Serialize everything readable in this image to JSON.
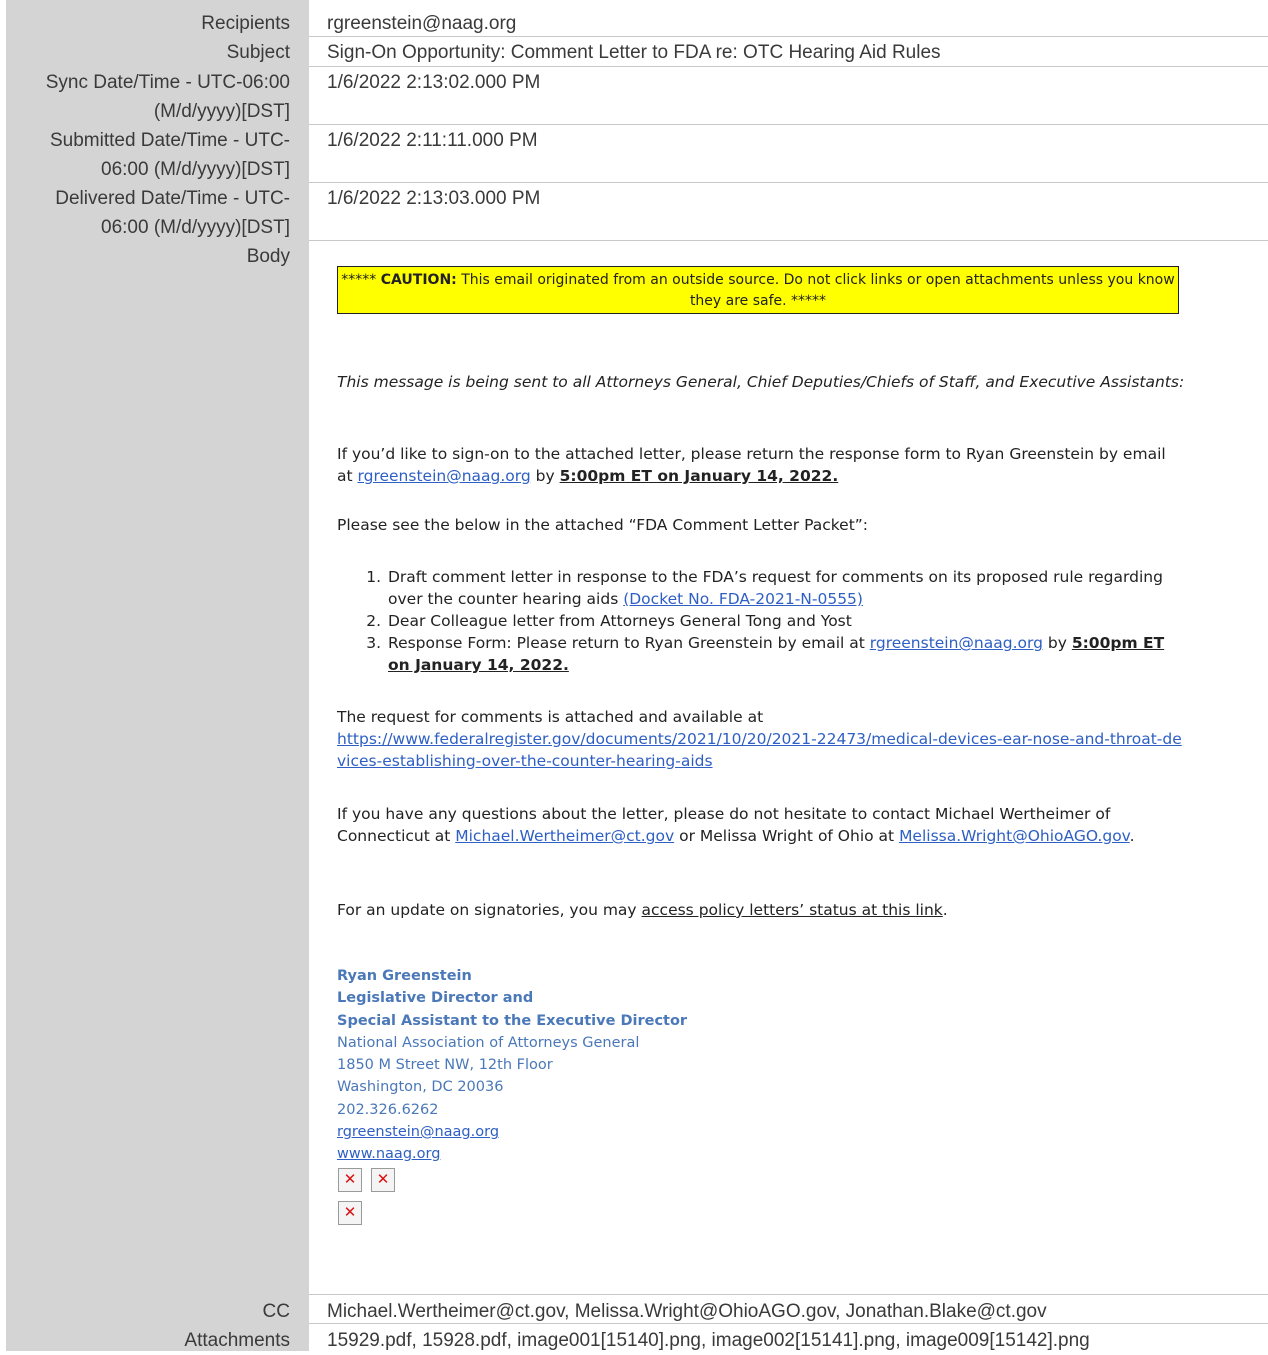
{
  "fields": {
    "recipients_label": "Recipients",
    "recipients_value": "rgreenstein@naag.org",
    "subject_label": "Subject",
    "subject_value": "Sign-On Opportunity: Comment Letter to FDA re: OTC Hearing Aid Rules",
    "sync_label_1": "Sync Date/Time - UTC-06:00",
    "sync_label_2": "(M/d/yyyy)[DST]",
    "sync_value": "1/6/2022 2:13:02.000 PM",
    "submitted_label_1": "Submitted Date/Time - UTC-",
    "submitted_label_2": "06:00 (M/d/yyyy)[DST]",
    "submitted_value": "1/6/2022 2:11:11.000 PM",
    "delivered_label_1": "Delivered Date/Time - UTC-",
    "delivered_label_2": "06:00 (M/d/yyyy)[DST]",
    "delivered_value": "1/6/2022 2:13:03.000 PM",
    "body_label": "Body",
    "cc_label": "CC",
    "cc_value": "Michael.Wertheimer@ct.gov, Melissa.Wright@OhioAGO.gov, Jonathan.Blake@ct.gov",
    "attachments_label": "Attachments",
    "attachments_value": "15929.pdf, 15928.pdf, image001[15140].png, image002[15141].png, image009[15142].png"
  },
  "email": {
    "caution_prefix": "***** ",
    "caution_bold": "CAUTION:",
    "caution_text": " This email originated from an outside source. Do not click links or open attachments unless you know they are safe. *****",
    "intro": "This message is being sent to all Attorneys General, Chief Deputies/Chiefs of Staff, and Executive Assistants:",
    "signon_a": "If you’d like to sign-on to the attached letter, please return the response form to Ryan Greenstein by email at ",
    "signon_link": "rgreenstein@naag.org",
    "signon_b": " by ",
    "signon_deadline": "5:00pm ET on January 14, 2022.",
    "packet_intro": "Please see the below in the attached “FDA Comment Letter Packet”:",
    "item1_a": "Draft comment letter in response to the FDA’s request for comments on its proposed rule regarding over the counter hearing aids ",
    "item1_link": "(Docket No. FDA-2021-N-0555)",
    "item2": "Dear Colleague letter from Attorneys General Tong and Yost",
    "item3_a": "Response Form: Please return to Ryan Greenstein by email at ",
    "item3_link": "rgreenstein@naag.org",
    "item3_b": " by ",
    "item3_deadline": "5:00pm ET on January 14, 2022.",
    "request_text": "The request for comments is attached and available at",
    "request_link": "https://www.federalregister.gov/documents/2021/10/20/2021-22473/medical-devices-ear-nose-and-throat-devices-establishing-over-the-counter-hearing-aids",
    "questions_a": "If you have any questions about the letter, please do not hesitate to contact Michael Wertheimer of Connecticut at ",
    "questions_link1": "Michael.Wertheimer@ct.gov",
    "questions_b": " or Melissa Wright of Ohio at ",
    "questions_link2": "Melissa.Wright@OhioAGO.gov",
    "questions_c": ".",
    "update_a": "For an update on signatories, you may ",
    "update_link": "access policy letters’ status at this link",
    "update_b": "."
  },
  "signature": {
    "name": "Ryan Greenstein",
    "title1": "Legislative Director and",
    "title2": "Special Assistant to the Executive Director",
    "org": "National Association of Attorneys General",
    "addr1": "1850 M Street NW, 12th Floor",
    "addr2": "Washington, DC 20036",
    "phone": "202.326.6262",
    "email": "rgreenstein@naag.org",
    "web": "www.naag.org"
  },
  "icons": {
    "broken_image": "broken-image-icon"
  }
}
